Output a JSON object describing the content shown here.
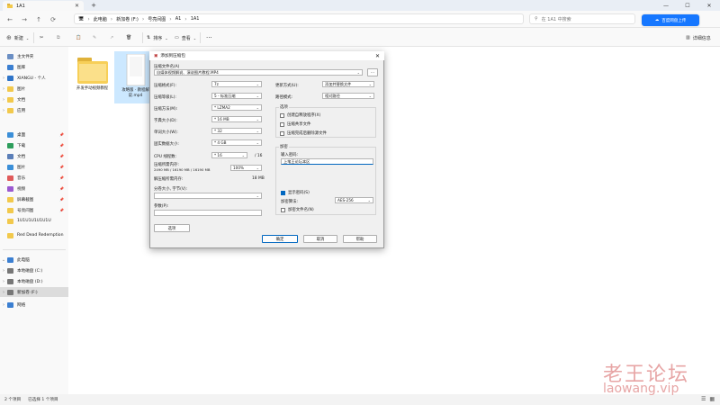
{
  "tab": {
    "title": "1A1"
  },
  "address": {
    "crumbs": [
      "此电脑",
      "新加卷 (F:)",
      "号亮间图",
      "A1",
      "1A1"
    ]
  },
  "search": {
    "placeholder": "在 1A1 中搜索"
  },
  "baidu": {
    "label": "百度网盘上传"
  },
  "toolbar": {
    "new": "新建",
    "sort": "排序",
    "view": "查看",
    "more": "···",
    "details": "详细信息"
  },
  "sidebar": {
    "top": [
      {
        "label": "主文件夹",
        "icon": "home-icon",
        "chev": ""
      },
      {
        "label": "图库",
        "icon": "gallery-icon",
        "chev": ""
      },
      {
        "label": "XIANGU - 个人",
        "icon": "cloud-icon",
        "chev": "›"
      },
      {
        "label": "图片",
        "icon": "folder-icon",
        "chev": "›"
      },
      {
        "label": "文档",
        "icon": "folder-icon",
        "chev": "›"
      },
      {
        "label": "应用",
        "icon": "folder-icon",
        "chev": "›"
      }
    ],
    "quick": [
      {
        "label": "桌面",
        "icon": "desktop-icon"
      },
      {
        "label": "下载",
        "icon": "download-icon"
      },
      {
        "label": "文档",
        "icon": "document-icon"
      },
      {
        "label": "图片",
        "icon": "picture-icon"
      },
      {
        "label": "音乐",
        "icon": "music-icon"
      },
      {
        "label": "视频",
        "icon": "video-icon"
      },
      {
        "label": "屏幕截图",
        "icon": "folder-icon"
      },
      {
        "label": "号亮间图",
        "icon": "folder-icon"
      },
      {
        "label": "1U1U1U1U1U1U",
        "icon": "folder-icon"
      },
      {
        "label": "Red Dead Redemption",
        "icon": "folder-icon"
      }
    ],
    "drives": [
      {
        "label": "此电脑",
        "icon": "pc-icon",
        "chev": "⌄"
      },
      {
        "label": "本地磁盘 (C:)",
        "icon": "drive-icon",
        "chev": "›"
      },
      {
        "label": "本地磁盘 (D:)",
        "icon": "drive-icon",
        "chev": "›"
      },
      {
        "label": "新加卷 (F:)",
        "icon": "drive-icon",
        "chev": "›"
      },
      {
        "label": "网络",
        "icon": "network-icon",
        "chev": "›"
      }
    ]
  },
  "files": [
    {
      "name": "开发手动视频教程",
      "type": "folder"
    },
    {
      "name": "攻略版 · 教程解说.mp4",
      "type": "video"
    }
  ],
  "status": {
    "count": "2 个项目",
    "selected": "已选择 1 个项目"
  },
  "watermark": {
    "line1": "老王论坛",
    "line2": "laowang.vip"
  },
  "dialog": {
    "title": "添加到压缩包",
    "archive_label": "压缩文件名(A)",
    "archive_value": "自媒体视频解说、演说图片教程.MP4",
    "format_label": "压缩格式(F):",
    "format_value": "7z",
    "level_label": "压缩等级(L):",
    "level_value": "5 - 标准压缩",
    "method_label": "压缩方法(M):",
    "method_value": "* LZMA2",
    "dict_label": "字典大小(D):",
    "dict_value": "* 16 MB",
    "word_label": "单词大小(W):",
    "word_value": "* 32",
    "solid_label": "固实数据大小:",
    "solid_value": "* 4 GB",
    "cpu_label": "CPU 线程数:",
    "cpu_value": "* 16",
    "cpu_suffix": "/ 16",
    "mem_label": "压缩所需内存:",
    "mem_value": "2490 MB / 16190 MB / 16190 MB",
    "mem_percent": "100%",
    "decomp_label": "解压缩所需内存:",
    "decomp_value": "18 MB",
    "split_label": "分卷大小, 字节(V):",
    "params_label": "参数(P):",
    "update_label": "更新方式(U):",
    "update_value": "添加并替换文件",
    "path_label": "路径模式:",
    "path_value": "相对路径",
    "options_label": "选项",
    "opt1": "创建自释放程序(X)",
    "opt2": "压缩共享文件",
    "opt3": "压缩完成后删除源文件",
    "encrypt_label": "加密",
    "password_label": "输入密码:",
    "password_value": "上笔王论坛本区",
    "show_password": "显示密码(S)",
    "enc_method_label": "加密算法:",
    "enc_method_value": "AES-256",
    "encrypt_names": "加密文件名(N)",
    "options_button": "选项",
    "ok": "确定",
    "cancel": "取消",
    "help": "帮助"
  }
}
